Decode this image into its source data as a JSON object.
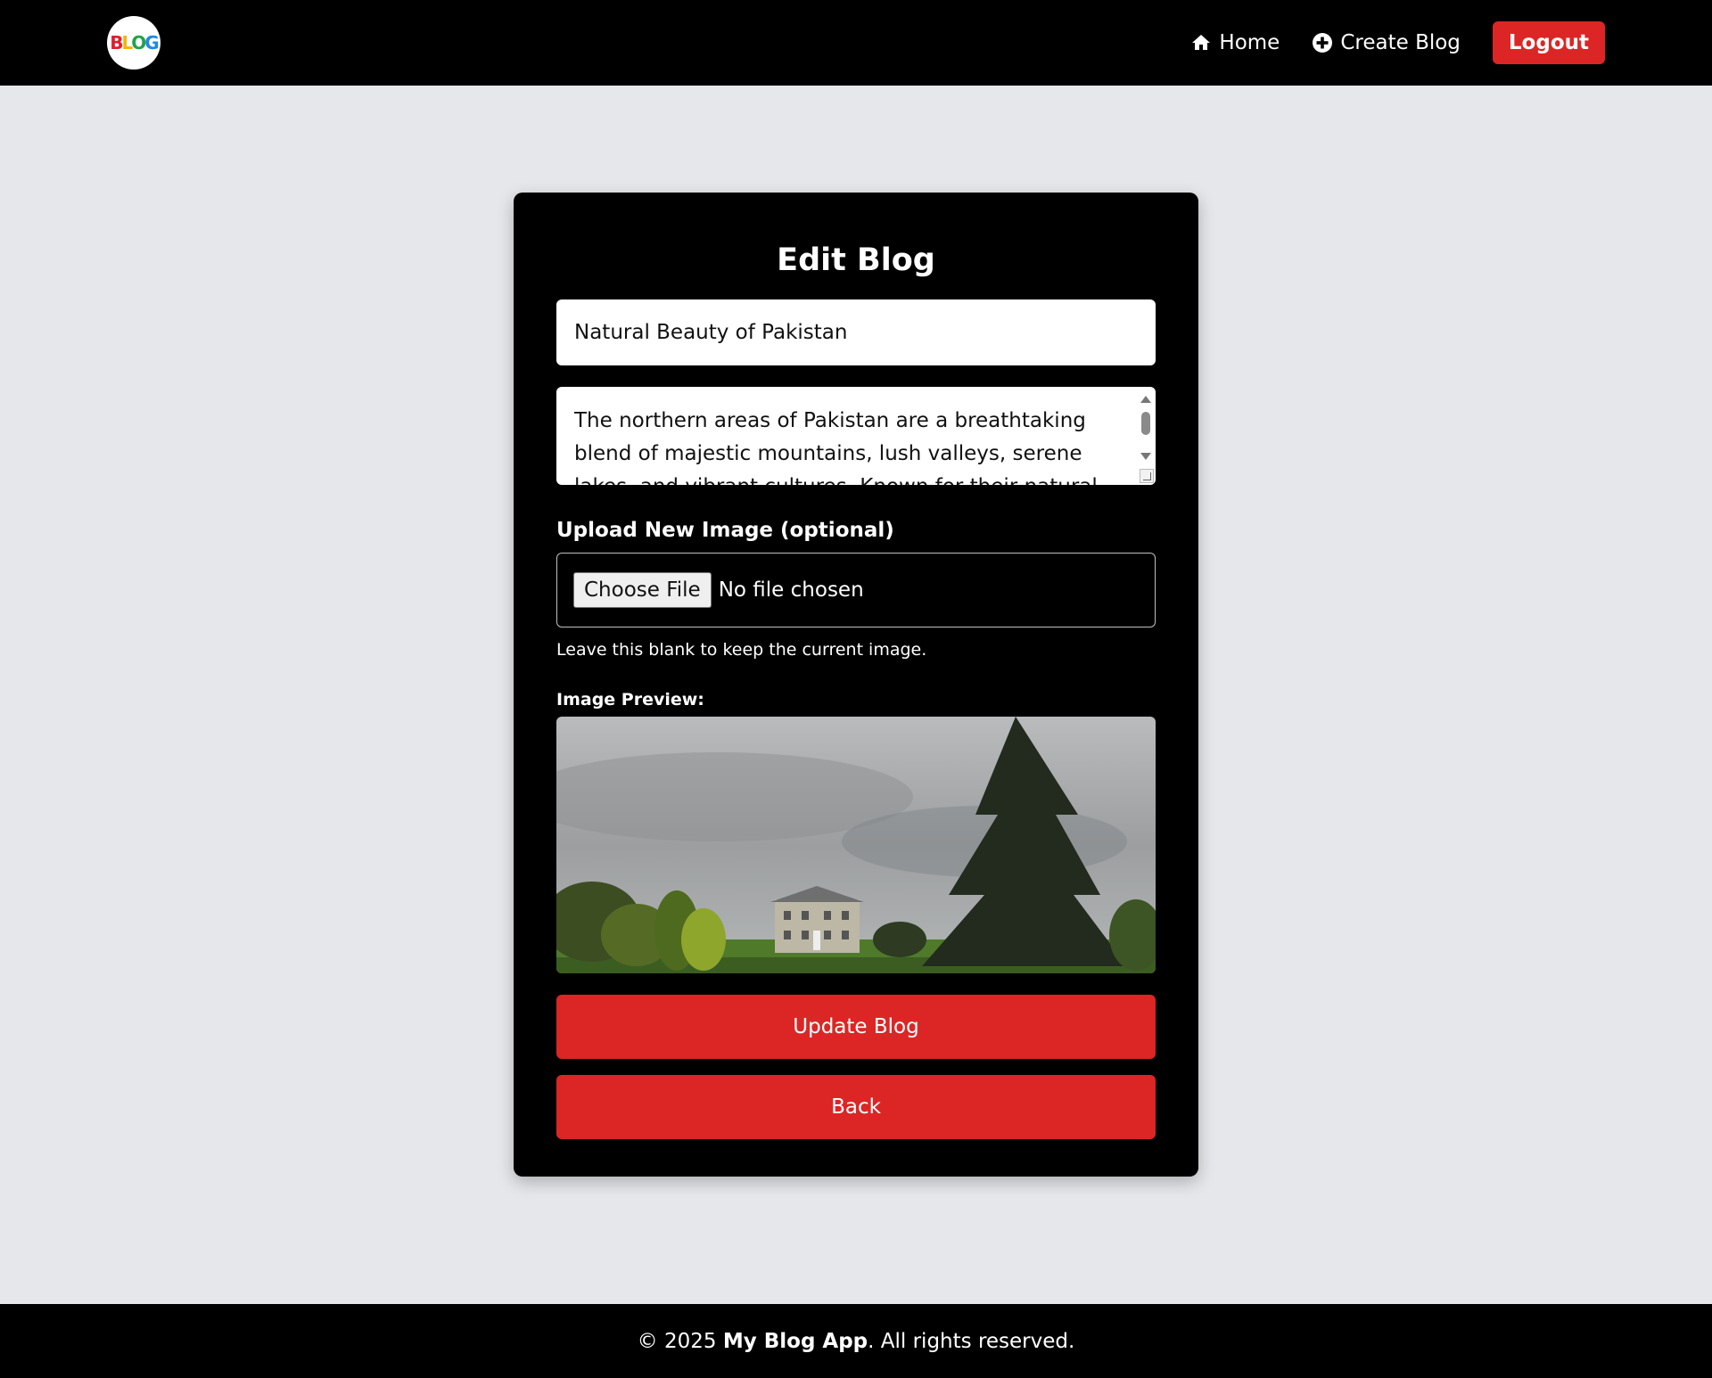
{
  "header": {
    "logo_text": "BLOG",
    "nav": [
      {
        "label": "Home",
        "icon": "home-icon"
      },
      {
        "label": "Create Blog",
        "icon": "plus-circle-icon"
      }
    ],
    "logout_label": "Logout"
  },
  "form": {
    "heading": "Edit Blog",
    "title_value": "Natural Beauty of Pakistan",
    "content_value": "The northern areas of Pakistan are a breathtaking blend of majestic mountains, lush valleys, serene lakes, and vibrant cultures. Known for their natural beauty and",
    "upload_label": "Upload New Image (optional)",
    "choose_file_label": "Choose File",
    "file_status": "No file chosen",
    "hint": "Leave this blank to keep the current image.",
    "preview_label": "Image Preview:",
    "update_label": "Update Blog",
    "back_label": "Back"
  },
  "footer": {
    "prefix": "© 2025 ",
    "app_name": "My Blog App",
    "suffix": ". All rights reserved."
  },
  "colors": {
    "accent": "#dc2626",
    "navbar": "#000000",
    "background": "#e5e7eb"
  }
}
